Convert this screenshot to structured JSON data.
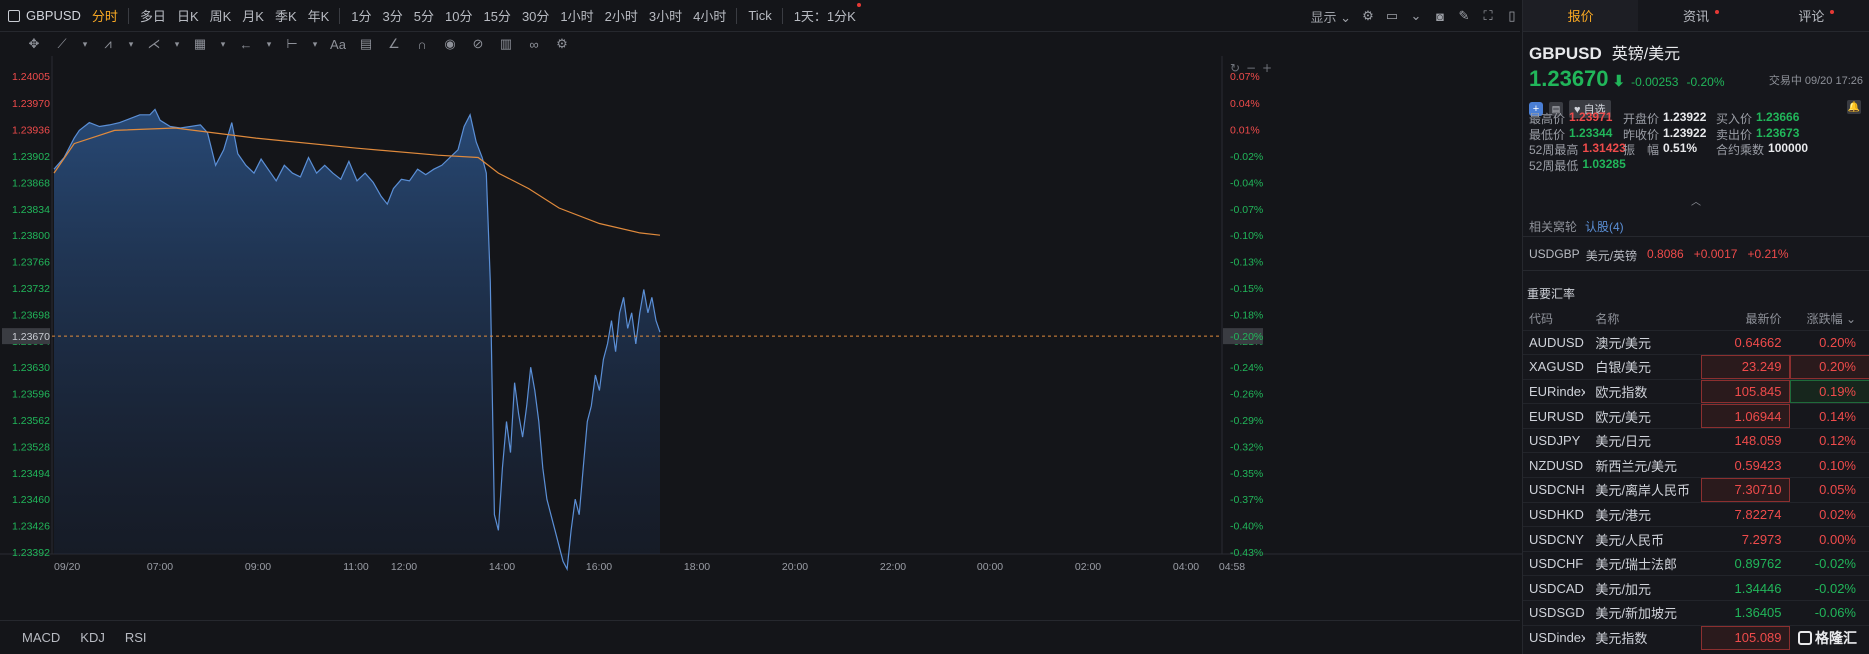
{
  "symbol": "GBPUSD",
  "periods": [
    {
      "label": "分时",
      "active": true
    },
    {
      "label": "多日"
    },
    {
      "label": "日K"
    },
    {
      "label": "周K"
    },
    {
      "label": "月K"
    },
    {
      "label": "季K"
    },
    {
      "label": "年K"
    },
    {
      "label": "1分"
    },
    {
      "label": "3分"
    },
    {
      "label": "5分"
    },
    {
      "label": "10分"
    },
    {
      "label": "15分"
    },
    {
      "label": "30分"
    },
    {
      "label": "1小时"
    },
    {
      "label": "2小时"
    },
    {
      "label": "3小时"
    },
    {
      "label": "4小时"
    },
    {
      "label": "Tick"
    },
    {
      "label": "1天：1分K",
      "dot": true
    }
  ],
  "display_label": "显示",
  "indicators": [
    "MACD",
    "KDJ",
    "RSI"
  ],
  "tabs": [
    {
      "label": "报价",
      "active": true
    },
    {
      "label": "资讯",
      "dot": true
    },
    {
      "label": "评论",
      "dot": true
    }
  ],
  "quote": {
    "code": "GBPUSD",
    "name": "英镑/美元",
    "price": "1.23670",
    "change": "-0.00253",
    "pct": "-0.20%",
    "time": "交易中 09/20 17:26",
    "watch_label": "自选",
    "fields": [
      {
        "label": "最高价",
        "value": "1.23971",
        "color": "red"
      },
      {
        "label": "开盘价",
        "value": "1.23922",
        "color": "white"
      },
      {
        "label": "买入价",
        "value": "1.23666",
        "color": "green"
      },
      {
        "label": "最低价",
        "value": "1.23344",
        "color": "green"
      },
      {
        "label": "昨收价",
        "value": "1.23922",
        "color": "white"
      },
      {
        "label": "卖出价",
        "value": "1.23673",
        "color": "green"
      },
      {
        "label": "52周最高",
        "value": "1.31423",
        "color": "red"
      },
      {
        "label": "振　幅",
        "value": "0.51%",
        "color": "white"
      },
      {
        "label": "合约乘数",
        "value": "100000",
        "color": "white"
      },
      {
        "label": "52周最低",
        "value": "1.03285",
        "color": "green"
      }
    ],
    "related_label": "相关窝轮",
    "related_link": "认股(4)",
    "pair": {
      "code": "USDGBP",
      "name": "美元/英镑",
      "price": "0.8086",
      "change": "+0.0017",
      "pct": "+0.21%"
    }
  },
  "fx_title": "重要汇率",
  "fx_headers": [
    "代码",
    "名称",
    "最新价",
    "涨跌幅"
  ],
  "fx_rows": [
    {
      "code": "AUDUSD",
      "name": "澳元/美元",
      "price": "0.64662",
      "pct": "0.20%",
      "color": "red",
      "hl": "none"
    },
    {
      "code": "XAGUSD",
      "name": "白银/美元",
      "price": "23.249",
      "pct": "0.20%",
      "color": "red",
      "hl": "both"
    },
    {
      "code": "EURindex",
      "name": "欧元指数",
      "price": "105.845",
      "pct": "0.19%",
      "color": "red",
      "hl": "px-green"
    },
    {
      "code": "EURUSD",
      "name": "欧元/美元",
      "price": "1.06944",
      "pct": "0.14%",
      "color": "red",
      "hl": "px"
    },
    {
      "code": "USDJPY",
      "name": "美元/日元",
      "price": "148.059",
      "pct": "0.12%",
      "color": "red",
      "hl": "none"
    },
    {
      "code": "NZDUSD",
      "name": "新西兰元/美元",
      "price": "0.59423",
      "pct": "0.10%",
      "color": "red",
      "hl": "none"
    },
    {
      "code": "USDCNH",
      "name": "美元/离岸人民币",
      "price": "7.30710",
      "pct": "0.05%",
      "color": "red",
      "hl": "px"
    },
    {
      "code": "USDHKD",
      "name": "美元/港元",
      "price": "7.82274",
      "pct": "0.02%",
      "color": "red",
      "hl": "none"
    },
    {
      "code": "USDCNY",
      "name": "美元/人民币",
      "price": "7.2973",
      "pct": "0.00%",
      "color": "red",
      "hl": "none"
    },
    {
      "code": "USDCHF",
      "name": "美元/瑞士法郎",
      "price": "0.89762",
      "pct": "-0.02%",
      "color": "green",
      "hl": "none"
    },
    {
      "code": "USDCAD",
      "name": "美元/加元",
      "price": "1.34446",
      "pct": "-0.02%",
      "color": "green",
      "hl": "none"
    },
    {
      "code": "USDSGD",
      "name": "美元/新加坡元",
      "price": "1.36405",
      "pct": "-0.06%",
      "color": "green",
      "hl": "none"
    },
    {
      "code": "USDindex",
      "name": "美元指数",
      "price": "105.089",
      "pct": "",
      "color": "red",
      "hl": "px"
    }
  ],
  "watermark": "格隆汇",
  "colors": {
    "up": "#ef4b4b",
    "down": "#21b65a",
    "accent": "#f5a623",
    "line": "#5b8fd6",
    "avg": "#e08a3c"
  },
  "chart_data": {
    "type": "line",
    "y_ticks": [
      "1.24005",
      "1.23970",
      "1.23936",
      "1.23902",
      "1.23868",
      "1.23834",
      "1.23800",
      "1.23766",
      "1.23732",
      "1.23698",
      "1.23664",
      "1.23630",
      "1.23596",
      "1.23562",
      "1.23528",
      "1.23494",
      "1.23460",
      "1.23426",
      "1.23392"
    ],
    "pct_ticks": [
      "0.07%",
      "0.04%",
      "0.01%",
      "-0.02%",
      "-0.04%",
      "-0.07%",
      "-0.10%",
      "-0.13%",
      "-0.15%",
      "-0.18%",
      "-0.21%",
      "-0.24%",
      "-0.26%",
      "-0.29%",
      "-0.32%",
      "-0.35%",
      "-0.37%",
      "-0.40%",
      "-0.43%"
    ],
    "x_ticks": [
      "09/20",
      "07:00",
      "09:00",
      "11:00",
      "12:00",
      "14:00",
      "16:00",
      "18:00",
      "20:00",
      "22:00",
      "00:00",
      "02:00",
      "04:00",
      "04:58"
    ],
    "current": "1.23670",
    "current_pct": "-0.20%",
    "ylim": [
      1.23392,
      1.24005
    ],
    "series": [
      {
        "name": "price",
        "values": [
          [
            0,
            1.23885
          ],
          [
            10,
            1.239
          ],
          [
            20,
            1.23925
          ],
          [
            25,
            1.23935
          ],
          [
            35,
            1.23945
          ],
          [
            45,
            1.2394
          ],
          [
            55,
            1.23942
          ],
          [
            65,
            1.23945
          ],
          [
            75,
            1.2395
          ],
          [
            85,
            1.23955
          ],
          [
            95,
            1.23955
          ],
          [
            100,
            1.23962
          ],
          [
            105,
            1.23948
          ],
          [
            115,
            1.2394
          ],
          [
            125,
            1.23938
          ],
          [
            135,
            1.2394
          ],
          [
            145,
            1.23942
          ],
          [
            152,
            1.23932
          ],
          [
            160,
            1.2389
          ],
          [
            168,
            1.2391
          ],
          [
            176,
            1.23945
          ],
          [
            182,
            1.23905
          ],
          [
            190,
            1.2389
          ],
          [
            198,
            1.2388
          ],
          [
            205,
            1.23898
          ],
          [
            212,
            1.23885
          ],
          [
            220,
            1.2387
          ],
          [
            228,
            1.2389
          ],
          [
            236,
            1.2388
          ],
          [
            244,
            1.23875
          ],
          [
            252,
            1.239
          ],
          [
            260,
            1.2388
          ],
          [
            268,
            1.2389
          ],
          [
            276,
            1.2388
          ],
          [
            284,
            1.23872
          ],
          [
            292,
            1.23895
          ],
          [
            300,
            1.2387
          ],
          [
            308,
            1.2388
          ],
          [
            316,
            1.23868
          ],
          [
            324,
            1.2385
          ],
          [
            330,
            1.2384
          ],
          [
            336,
            1.2386
          ],
          [
            344,
            1.23872
          ],
          [
            352,
            1.2387
          ],
          [
            360,
            1.23885
          ],
          [
            368,
            1.23878
          ],
          [
            376,
            1.23885
          ],
          [
            384,
            1.2389
          ],
          [
            392,
            1.239
          ],
          [
            400,
            1.2391
          ],
          [
            406,
            1.2394
          ],
          [
            412,
            1.23955
          ],
          [
            418,
            1.2392
          ],
          [
            424,
            1.239
          ],
          [
            428,
            1.2388
          ],
          [
            432,
            1.2374
          ],
          [
            436,
            1.2344
          ],
          [
            440,
            1.2342
          ],
          [
            444,
            1.235
          ],
          [
            448,
            1.2356
          ],
          [
            452,
            1.2352
          ],
          [
            456,
            1.2361
          ],
          [
            460,
            1.2357
          ],
          [
            464,
            1.2354
          ],
          [
            468,
            1.2358
          ],
          [
            472,
            1.2363
          ],
          [
            476,
            1.236
          ],
          [
            480,
            1.2356
          ],
          [
            484,
            1.235
          ],
          [
            488,
            1.2346
          ],
          [
            492,
            1.2344
          ],
          [
            496,
            1.2342
          ],
          [
            500,
            1.234
          ],
          [
            504,
            1.2338
          ],
          [
            508,
            1.2337
          ],
          [
            512,
            1.2342
          ],
          [
            516,
            1.2346
          ],
          [
            520,
            1.2344
          ],
          [
            524,
            1.235
          ],
          [
            528,
            1.2356
          ],
          [
            532,
            1.2358
          ],
          [
            536,
            1.2362
          ],
          [
            540,
            1.236
          ],
          [
            544,
            1.2364
          ],
          [
            548,
            1.2366
          ],
          [
            552,
            1.2369
          ],
          [
            556,
            1.2365
          ],
          [
            560,
            1.237
          ],
          [
            564,
            1.2372
          ],
          [
            568,
            1.2368
          ],
          [
            572,
            1.237
          ],
          [
            576,
            1.2366
          ],
          [
            580,
            1.237
          ],
          [
            584,
            1.2373
          ],
          [
            588,
            1.237
          ],
          [
            592,
            1.2372
          ],
          [
            596,
            1.2369
          ],
          [
            600,
            1.23675
          ]
        ]
      },
      {
        "name": "avg",
        "values": [
          [
            0,
            1.2388
          ],
          [
            20,
            1.23918
          ],
          [
            60,
            1.23935
          ],
          [
            120,
            1.23938
          ],
          [
            200,
            1.23925
          ],
          [
            300,
            1.23912
          ],
          [
            380,
            1.23903
          ],
          [
            420,
            1.239
          ],
          [
            440,
            1.2388
          ],
          [
            470,
            1.2386
          ],
          [
            500,
            1.23835
          ],
          [
            540,
            1.23815
          ],
          [
            580,
            1.23803
          ],
          [
            600,
            1.238
          ]
        ]
      }
    ]
  }
}
